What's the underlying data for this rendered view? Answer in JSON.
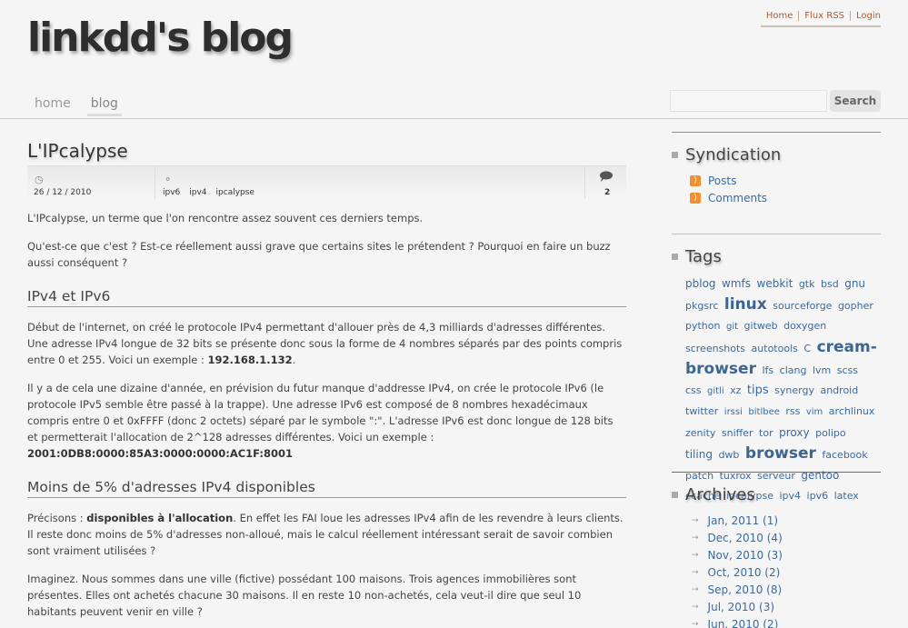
{
  "site": {
    "title": "linkdd's blog",
    "toplinks": [
      "Home",
      "Flux RSS",
      "Login"
    ],
    "nav": [
      {
        "label": "home",
        "active": false
      },
      {
        "label": "blog",
        "active": true
      }
    ],
    "search_button": "Search"
  },
  "post": {
    "title": "L'IPcalypse",
    "date": "26 / 12 / 2010",
    "tags": [
      "ipv6",
      "ipv4",
      "ipcalypse"
    ],
    "comments": "2",
    "intro1": "L'IPcalypse, un terme que l'on rencontre assez souvent ces derniers temps.",
    "intro2": "Qu'est-ce que c'est ? Est-ce réellement aussi grave que certains sites le prétendent ? Pourquoi en faire un buzz aussi conséquent ?",
    "h1": "IPv4 et IPv6",
    "p1a": "Début de l'internet, on créé le protocole IPv4 permettant d'allouer près de 4,3 milliards d'adresses différentes. Une adresse IPv4 longue de 32 bits se présente donc sous la forme de 4 nombres séparés par des points compris entre 0 et 255. Voici un exemple : ",
    "p1b": "192.168.1.132",
    "p1c": ".",
    "p2a": "Il y a de cela une dizaine d'année, en prévision du futur manque d'addresse IPv4, on crée le protocole IPv6 (le protocole IPv5 semble être passé à la trappe). Une adresse IPv6 est composé de 8 nombres hexadécimaux compris entre 0 et 0xFFFF (donc 2 octets) séparé par le symbole \":\". L'adresse IPv6 est donc longue de 128 bits et permetterait l'allocation de 2^128 adresses différentes. Voici un exemple : ",
    "p2b": "2001:0DB8:0000:85A3:0000:0000:AC1F:8001",
    "h2": "Moins de 5% d'adresses IPv4 disponibles",
    "p3a": "Précisons : ",
    "p3b": "disponibles à l'allocation",
    "p3c": ". En effet les FAI loue les adresses IPv4 afin de les revendre à leurs clients. Il reste donc moins de 5% d'adresses non-alloué, mais le calcul réellement intéressant serait de savoir combien sont vraiment utilisées ?",
    "p4": "Imaginez. Nous sommes dans une ville (fictive) possédant 100 maisons. Trois agences immobilières sont présentes. Elles ont achetés chacune 30 maisons. Il en reste 10 non-achetés, cela veut-il dire que seul 10 habitants peuvent venir en ville ?"
  },
  "sidebar": {
    "syndication_title": "Syndication",
    "feeds": [
      "Posts",
      "Comments"
    ],
    "tags_title": "Tags",
    "tags": [
      [
        "pblog",
        3
      ],
      [
        "wmfs",
        3
      ],
      [
        "webkit",
        3
      ],
      [
        "gtk",
        2
      ],
      [
        "bsd",
        2
      ],
      [
        "gnu",
        3
      ],
      [
        "pkgsrc",
        2
      ],
      [
        "linux",
        5
      ],
      [
        "sourceforge",
        2
      ],
      [
        "gopher",
        2
      ],
      [
        "python",
        2
      ],
      [
        "git",
        1
      ],
      [
        "gitweb",
        2
      ],
      [
        "doxygen",
        2
      ],
      [
        "screenshots",
        2
      ],
      [
        "autotools",
        2
      ],
      [
        "C",
        2
      ],
      [
        "cream-browser",
        5
      ],
      [
        "lfs",
        2
      ],
      [
        "clang",
        2
      ],
      [
        "lvm",
        2
      ],
      [
        "scss",
        2
      ],
      [
        "css",
        2
      ],
      [
        "gitli",
        1
      ],
      [
        "xz",
        2
      ],
      [
        "tips",
        4
      ],
      [
        "synergy",
        2
      ],
      [
        "android",
        2
      ],
      [
        "twitter",
        2
      ],
      [
        "irssi",
        1
      ],
      [
        "bitlbee",
        1
      ],
      [
        "rss",
        2
      ],
      [
        "vim",
        1
      ],
      [
        "archlinux",
        2
      ],
      [
        "zenity",
        2
      ],
      [
        "sniffer",
        2
      ],
      [
        "tor",
        2
      ],
      [
        "proxy",
        3
      ],
      [
        "polipo",
        2
      ],
      [
        "tiling",
        3
      ],
      [
        "dwb",
        2
      ],
      [
        "browser",
        5
      ],
      [
        "facebook",
        2
      ],
      [
        "patch",
        2
      ],
      [
        "tuxrox",
        2
      ],
      [
        "serveur",
        2
      ],
      [
        "gentoo",
        3
      ],
      [
        "ccache",
        2
      ],
      [
        "ipcalypse",
        2
      ],
      [
        "ipv4",
        2
      ],
      [
        "ipv6",
        2
      ],
      [
        "latex",
        2
      ]
    ],
    "archives_title": "Archives",
    "archives": [
      "Jan, 2011 (1)",
      "Dec, 2010 (4)",
      "Nov, 2010 (3)",
      "Oct, 2010 (2)",
      "Sep, 2010 (8)",
      "Jul, 2010 (3)",
      "Jun, 2010 (2)"
    ]
  },
  "icons": {
    "clock": "clock-icon",
    "tag": "tag-icon",
    "comment": "comment-icon",
    "rss": "rss-icon"
  },
  "colors": {
    "link": "#3a6aa0",
    "toplink": "#b05a2a",
    "syndication_rule": "#d47e4a",
    "tags_rule": "#b8d078",
    "archives_rule": "#c8473a"
  }
}
